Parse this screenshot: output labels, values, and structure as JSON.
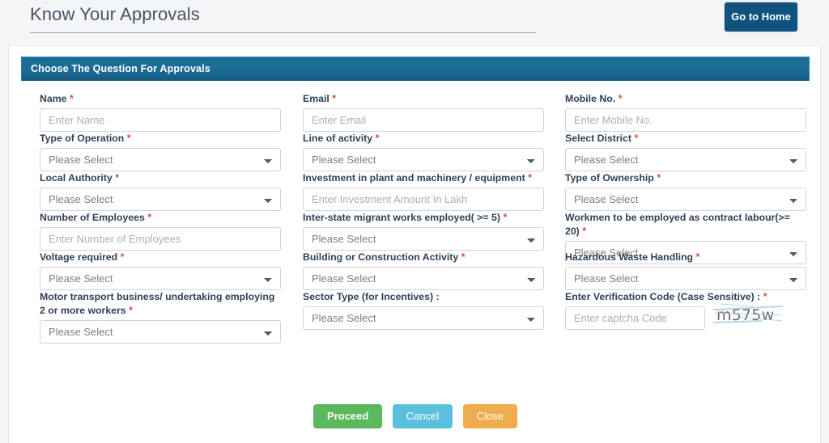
{
  "header": {
    "title": "Know Your Approvals",
    "go_home_label": "Go to Home"
  },
  "panel": {
    "title": "Choose The Question For Approvals"
  },
  "placeholders": {
    "please_select": "Please Select"
  },
  "fields": [
    {
      "name": "name",
      "label": "Name",
      "required": true,
      "control": "text",
      "value": "",
      "placeholder": "Enter Name"
    },
    {
      "name": "email",
      "label": "Email",
      "required": true,
      "control": "text",
      "value": "",
      "placeholder": "Enter Email"
    },
    {
      "name": "mobile-no",
      "label": "Mobile No.",
      "required": true,
      "control": "text",
      "value": "",
      "placeholder": "Enter Mobile No."
    },
    {
      "name": "type-of-operation",
      "label": "Type of Operation",
      "required": true,
      "control": "select",
      "value": "Please Select"
    },
    {
      "name": "line-of-activity",
      "label": "Line of activity",
      "required": true,
      "control": "select",
      "value": "Please Select"
    },
    {
      "name": "select-district",
      "label": "Select District",
      "required": true,
      "control": "select",
      "value": "Please Select"
    },
    {
      "name": "local-authority",
      "label": "Local Authority",
      "required": true,
      "control": "select",
      "value": "Please Select"
    },
    {
      "name": "investment-in-plant-and-machinery",
      "label": "Investment in plant and machinery / equipment",
      "required": true,
      "control": "text",
      "value": "",
      "placeholder": "Enter Investment Amount In Lakh"
    },
    {
      "name": "type-of-ownership",
      "label": "Type of Ownership",
      "required": true,
      "control": "select",
      "value": "Please Select"
    },
    {
      "name": "number-of-employees",
      "label": "Number of Employees",
      "required": true,
      "control": "text",
      "value": "",
      "placeholder": "Enter Number of Employees"
    },
    {
      "name": "inter-state-migrant-works-employed",
      "label": "Inter-state migrant works employed( >= 5)",
      "required": true,
      "control": "select",
      "value": "Please Select"
    },
    {
      "name": "workmen-contract-labour",
      "label": "Workmen to be employed as contract labour(>= 20)",
      "required": true,
      "control": "select",
      "value": "Please Select"
    },
    {
      "name": "voltage-required",
      "label": "Voltage required",
      "required": true,
      "control": "select",
      "value": "Please Select"
    },
    {
      "name": "building-or-construction-activity",
      "label": "Building or Construction Activity",
      "required": true,
      "control": "select",
      "value": "Please Select"
    },
    {
      "name": "hazardous-waste-handling",
      "label": "Hazardous Waste Handling",
      "required": true,
      "control": "select",
      "value": "Please Select"
    },
    {
      "name": "motor-transport-business",
      "label": "Motor transport business/ undertaking employing 2 or more workers",
      "required": true,
      "control": "select",
      "value": "Please Select"
    },
    {
      "name": "sector-type-for-incentives",
      "label": "Sector Type (for Incentives) :",
      "required": false,
      "control": "select",
      "value": "Please Select"
    },
    {
      "name": "verification-code",
      "label": "Enter Verification Code (Case Sensitive) :",
      "required": true,
      "control": "captcha",
      "value": "",
      "placeholder": "Enter captcha Code",
      "captcha_text": "m575w"
    }
  ],
  "buttons": {
    "proceed": "Proceed",
    "cancel": "Cancel",
    "close": "Close"
  },
  "colors": {
    "panel_header": "#1c6a96",
    "go_home": "#0f537e",
    "required_asterisk": "#d9534f",
    "proceed": "#5cb85c",
    "cancel": "#5bc0de",
    "close": "#f0ad4e",
    "label": "#2f4157"
  }
}
